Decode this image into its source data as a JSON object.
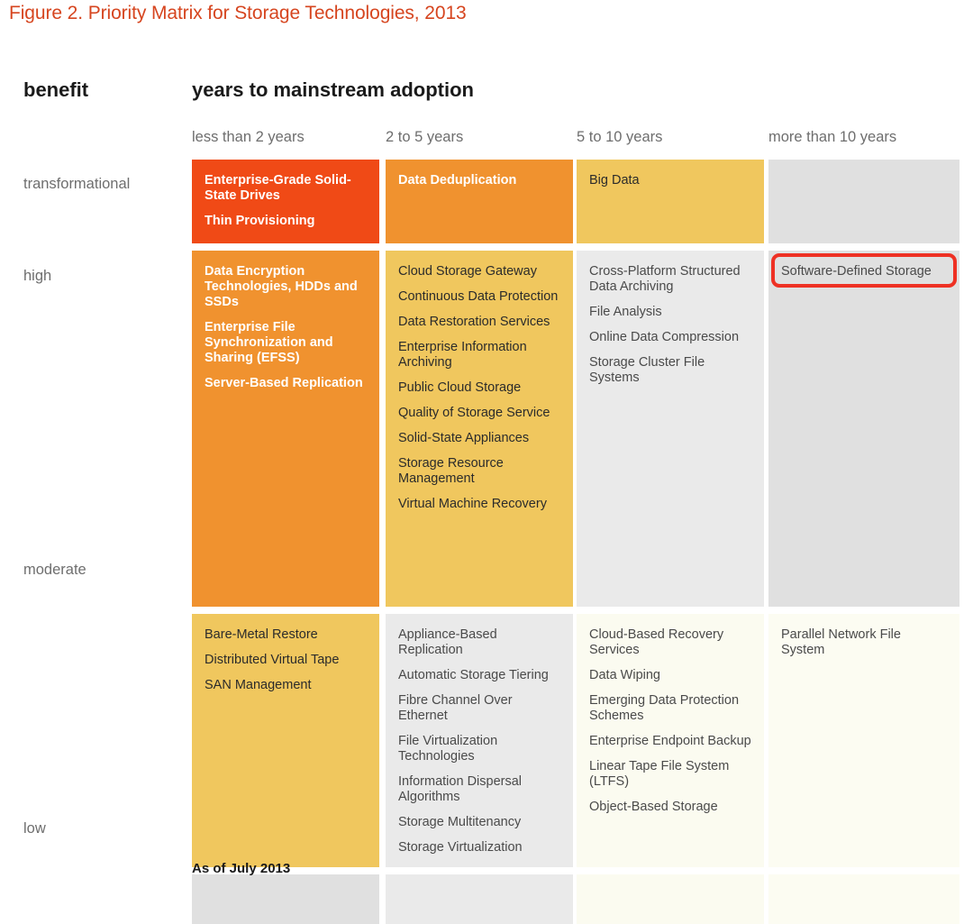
{
  "title": "Figure 2. Priority Matrix for Storage Technologies, 2013",
  "axes": {
    "y_axis_label": "benefit",
    "x_axis_label": "years to mainstream adoption"
  },
  "columns": [
    {
      "label": "less than 2 years"
    },
    {
      "label": "2 to 5 years"
    },
    {
      "label": "5 to 10 years"
    },
    {
      "label": "more than 10 years"
    }
  ],
  "rows": [
    {
      "label": "transformational"
    },
    {
      "label": "high"
    },
    {
      "label": "moderate"
    },
    {
      "label": "low"
    }
  ],
  "colors": {
    "title": "#d6451f",
    "red": "#f04a16",
    "orange": "#f0922f",
    "yellow": "#f0c75e",
    "gray": "#e0e0e0",
    "cream": "#fbfbf0",
    "annotation": "#ee3124"
  },
  "cells": {
    "transformational": {
      "less_than_2_years": [
        "Enterprise-Grade Solid-State Drives",
        "Thin Provisioning"
      ],
      "2_to_5_years": [
        "Data Deduplication"
      ],
      "5_to_10_years": [
        "Big Data"
      ],
      "more_than_10_years": []
    },
    "high": {
      "less_than_2_years": [
        "Data Encryption Technologies, HDDs and SSDs",
        "Enterprise File Synchronization and Sharing (EFSS)",
        "Server-Based Replication"
      ],
      "2_to_5_years": [
        "Cloud Storage Gateway",
        "Continuous Data Protection",
        "Data Restoration Services",
        "Enterprise Information Archiving",
        "Public Cloud Storage",
        "Quality of Storage Service",
        "Solid-State Appliances",
        "Storage Resource Management",
        "Virtual Machine Recovery"
      ],
      "5_to_10_years": [
        "Cross-Platform Structured Data Archiving",
        "File Analysis",
        "Online Data Compression",
        "Storage Cluster File Systems"
      ],
      "more_than_10_years": [
        "Software-Defined Storage"
      ]
    },
    "moderate": {
      "less_than_2_years": [
        "Bare-Metal Restore",
        "Distributed Virtual Tape",
        "SAN Management"
      ],
      "2_to_5_years": [
        "Appliance-Based Replication",
        "Automatic Storage Tiering",
        "Fibre Channel Over Ethernet",
        "File Virtualization Technologies",
        "Information Dispersal Algorithms",
        "Storage Multitenancy",
        "Storage Virtualization"
      ],
      "5_to_10_years": [
        "Cloud-Based Recovery Services",
        "Data Wiping",
        "Emerging Data Protection Schemes",
        "Enterprise Endpoint Backup",
        "Linear Tape File System (LTFS)",
        "Object-Based Storage"
      ],
      "more_than_10_years": [
        "Parallel Network File System"
      ]
    },
    "low": {
      "less_than_2_years": [],
      "2_to_5_years": [],
      "5_to_10_years": [],
      "more_than_10_years": []
    }
  },
  "highlight": {
    "target": "Software-Defined Storage"
  },
  "footnote": "As of July 2013"
}
